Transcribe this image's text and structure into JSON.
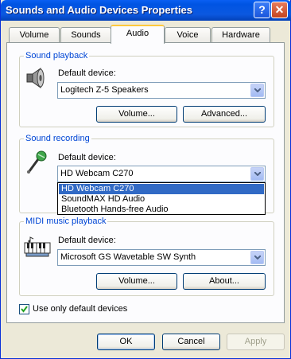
{
  "window": {
    "title": "Sounds and Audio Devices Properties",
    "help_glyph": "?",
    "close_glyph": "✕"
  },
  "tabs": [
    {
      "label": "Volume"
    },
    {
      "label": "Sounds"
    },
    {
      "label": "Audio",
      "active": true
    },
    {
      "label": "Voice"
    },
    {
      "label": "Hardware"
    }
  ],
  "playback": {
    "legend": "Sound playback",
    "default_label": "Default device:",
    "device": "Logitech Z-5 Speakers",
    "volume_button": "Volume...",
    "advanced_button": "Advanced...",
    "icon": "speaker-icon"
  },
  "recording": {
    "legend": "Sound recording",
    "default_label": "Default device:",
    "device": "HD Webcam C270",
    "icon": "microphone-icon",
    "options": [
      "HD Webcam C270",
      "SoundMAX HD Audio",
      "Bluetooth Hands-free Audio"
    ],
    "selected_index": 0
  },
  "midi": {
    "legend": "MIDI music playback",
    "default_label": "Default device:",
    "device": "Microsoft GS Wavetable SW Synth",
    "volume_button": "Volume...",
    "about_button": "About...",
    "icon": "midi-keyboard-icon"
  },
  "use_default_only": {
    "label": "Use only default devices",
    "checked": true
  },
  "footer": {
    "ok": "OK",
    "cancel": "Cancel",
    "apply": "Apply"
  },
  "colors": {
    "title_bar": "#0054e3",
    "group_legend": "#0046d5",
    "selection": "#316ac5",
    "active_tab_accent": "#ffc83c"
  }
}
